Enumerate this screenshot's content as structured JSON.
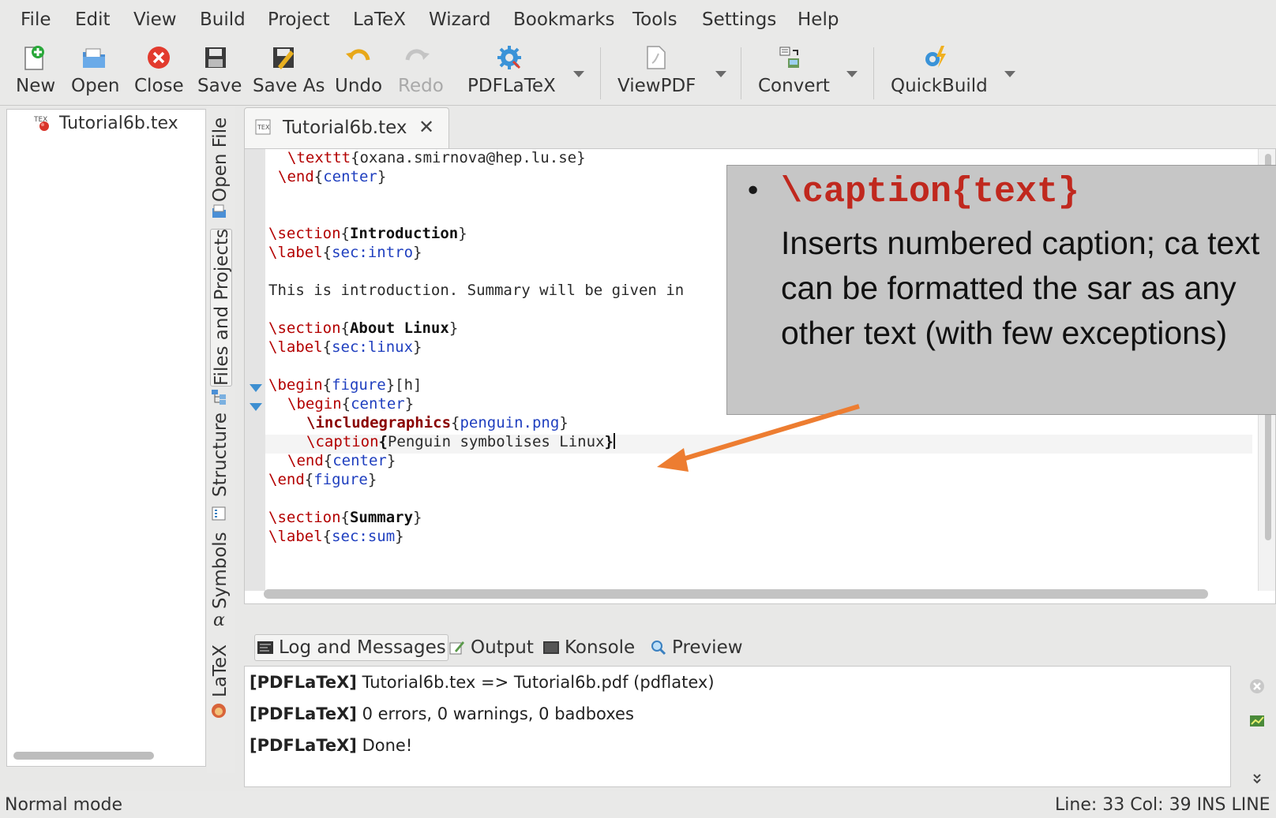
{
  "menu": [
    "File",
    "Edit",
    "View",
    "Build",
    "Project",
    "LaTeX",
    "Wizard",
    "Bookmarks",
    "Tools",
    "Settings",
    "Help"
  ],
  "toolbar": {
    "new": "New",
    "open": "Open",
    "close": "Close",
    "save": "Save",
    "save_as": "Save As",
    "undo": "Undo",
    "redo": "Redo",
    "pdflatex": "PDFLaTeX",
    "viewpdf": "ViewPDF",
    "convert": "Convert",
    "quickbuild": "QuickBuild"
  },
  "file_tree": {
    "item": "Tutorial6b.tex"
  },
  "side_tabs": {
    "open_file": "Open File",
    "files_projects": "Files and Projects",
    "structure": "Structure",
    "symbols": "Symbols",
    "latex": "LaTeX",
    "alpha": "α"
  },
  "editor": {
    "tab_label": "Tutorial6b.tex",
    "close_glyph": "✕",
    "lines": {
      "l1_cmd": "\\texttt",
      "l1_b1": "{",
      "l1_arg": "oxana.smirnova@hep.lu.se",
      "l1_b2": "}",
      "l2_cmd": "\\end",
      "l2_b1": "{",
      "l2_arg": "center",
      "l2_b2": "}",
      "l3_cmd": "\\section",
      "l3_b1": "{",
      "l3_arg": "Introduction",
      "l3_b2": "}",
      "l4_cmd": "\\label",
      "l4_b1": "{",
      "l4_arg": "sec:intro",
      "l4_b2": "}",
      "l5_text": "This is introduction. Summary will be given in",
      "l6_cmd": "\\section",
      "l6_b1": "{",
      "l6_arg": "About Linux",
      "l6_b2": "}",
      "l7_cmd": "\\label",
      "l7_b1": "{",
      "l7_arg": "sec:linux",
      "l7_b2": "}",
      "l8_cmd": "\\begin",
      "l8_b1": "{",
      "l8_arg": "figure",
      "l8_b2": "}[h]",
      "l9_cmd": "\\begin",
      "l9_b1": "{",
      "l9_arg": "center",
      "l9_b2": "}",
      "l10_cmd": "\\includegraphics",
      "l10_b1": "{",
      "l10_arg": "penguin.png",
      "l10_b2": "}",
      "l11_cmd": "\\caption",
      "l11_b1": "{",
      "l11_arg": "Penguin symbolises Linux",
      "l11_b2": "}",
      "l12_cmd": "\\end",
      "l12_b1": "{",
      "l12_arg": "center",
      "l12_b2": "}",
      "l13_cmd": "\\end",
      "l13_b1": "{",
      "l13_arg": "figure",
      "l13_b2": "}",
      "l14_cmd": "\\section",
      "l14_b1": "{",
      "l14_arg": "Summary",
      "l14_b2": "}",
      "l15_cmd": "\\label",
      "l15_b1": "{",
      "l15_arg": "sec:sum",
      "l15_b2": "}"
    }
  },
  "callout": {
    "bullet": "•",
    "code": "\\caption{text}",
    "text": "Inserts numbered caption; ca text can be formatted the sar as any other text (with few exceptions)",
    "arrow_color": "#ed7d31"
  },
  "messages": {
    "tabs": {
      "log": "Log and Messages",
      "output": "Output",
      "konsole": "Konsole",
      "preview": "Preview"
    },
    "lines": [
      {
        "tag": "[PDFLaTeX]",
        "text": " Tutorial6b.tex => Tutorial6b.pdf (pdflatex)"
      },
      {
        "tag": "[PDFLaTeX]",
        "text": " 0 errors, 0 warnings, 0 badboxes"
      },
      {
        "tag": "[PDFLaTeX]",
        "text": " Done!"
      }
    ]
  },
  "status": {
    "mode": "Normal mode",
    "position": "Line: 33 Col: 39  INS  LINE"
  },
  "colors": {
    "accent_arrow": "#ed7d31",
    "command_red": "#b30000",
    "argument_blue": "#1f3fbf",
    "fold_blue": "#3d8fd1",
    "callout_bg": "#c6c6c6",
    "callout_code": "#c0281e"
  }
}
